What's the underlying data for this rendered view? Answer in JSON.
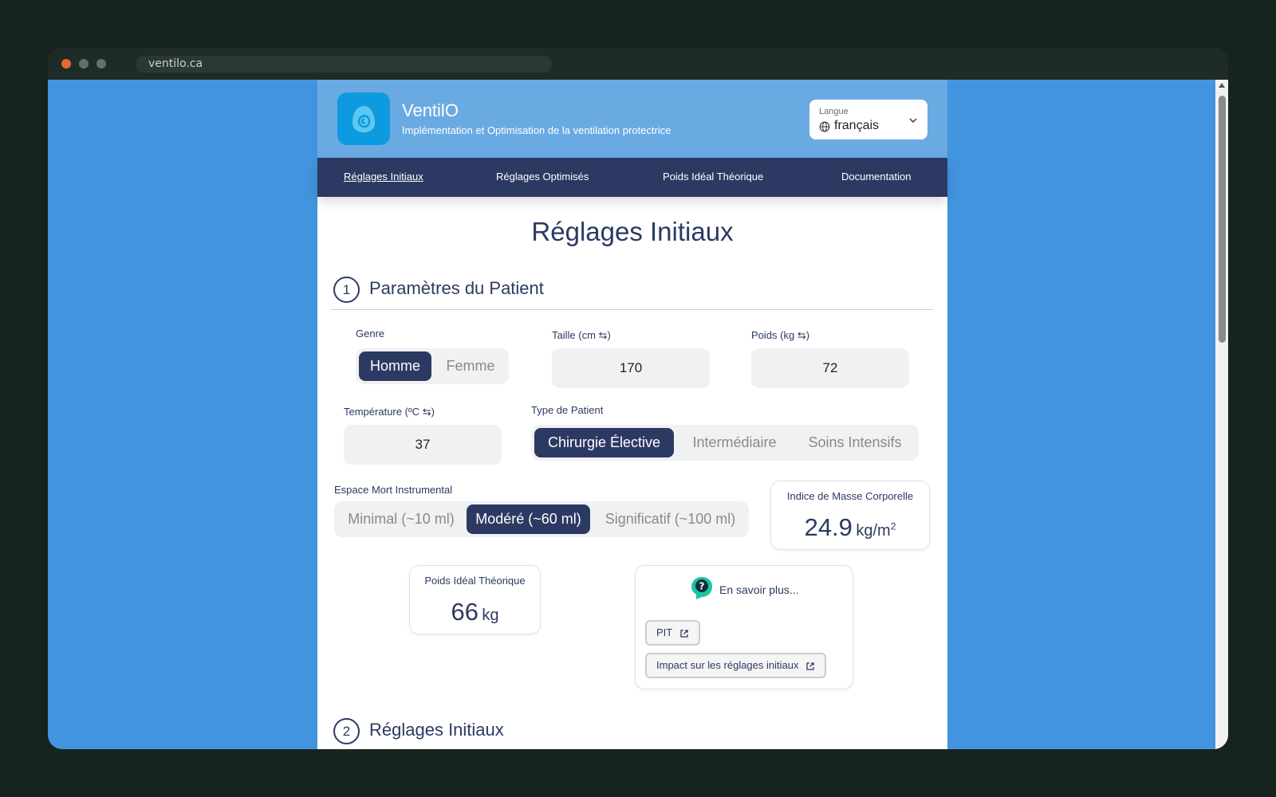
{
  "browser": {
    "url": "ventilo.ca"
  },
  "header": {
    "app_name": "VentilO",
    "tagline": "Implémentation et Optimisation de la ventilation protectrice",
    "language": {
      "label": "Langue",
      "value": "français"
    }
  },
  "nav": {
    "items": [
      {
        "label": "Réglages Initiaux",
        "active": true
      },
      {
        "label": "Réglages Optimisés"
      },
      {
        "label": "Poids Idéal Théorique"
      },
      {
        "label": "Documentation"
      }
    ]
  },
  "page_title": "Réglages Initiaux",
  "section1": {
    "number": "1",
    "title": "Paramètres du Patient",
    "gender": {
      "label": "Genre",
      "options": [
        "Homme",
        "Femme"
      ],
      "selected": "Homme"
    },
    "height": {
      "label": "Taille (cm",
      "swap": "⇆",
      "close": ")",
      "value": "170"
    },
    "weight": {
      "label": "Poids (kg",
      "swap": "⇆",
      "close": ")",
      "value": "72"
    },
    "temperature": {
      "label": "Température (ºC",
      "swap": "⇆",
      "close": ")",
      "value": "37"
    },
    "patient_type": {
      "label": "Type de Patient",
      "options": [
        "Chirurgie Élective",
        "Intermédiaire",
        "Soins Intensifs"
      ],
      "selected": "Chirurgie Élective"
    },
    "dead_space": {
      "label": "Espace Mort Instrumental",
      "options": [
        "Minimal (~10 ml)",
        "Modéré (~60 ml)",
        "Significatif (~100 ml)"
      ],
      "selected": "Modéré (~60 ml)"
    },
    "bmi": {
      "title": "Indice de Masse Corporelle",
      "value": "24.9",
      "unit": "kg/m",
      "unit_sup": "2"
    },
    "ibw": {
      "title": "Poids Idéal Théorique",
      "value": "66",
      "unit": "kg"
    },
    "learn_more": {
      "text": "En savoir plus...",
      "links": [
        "PIT",
        "Impact sur les réglages initiaux"
      ]
    }
  },
  "section2": {
    "number": "2",
    "title": "Réglages Initiaux"
  },
  "colors": {
    "primary": "#2c3a63",
    "header_bg": "#6aaae3",
    "accent": "#0e9ae0",
    "page_bg": "#4394df",
    "help_icon": "#1fc4a0"
  }
}
